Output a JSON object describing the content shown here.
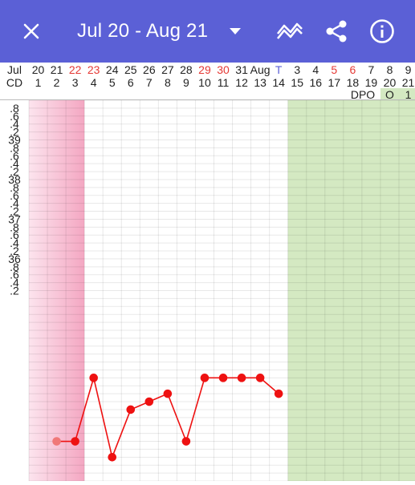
{
  "appbar": {
    "title": "Jul 20 - Aug 21",
    "background": "#5b60d6",
    "icons": [
      "close-icon",
      "chevron-down-icon",
      "chart-toggle-icon",
      "share-icon",
      "info-icon"
    ]
  },
  "header": {
    "row1_label": "Jul",
    "row2_label": "CD",
    "row3_label": "DPO",
    "columns": [
      {
        "date": "20",
        "cd": "1",
        "dpo": "",
        "color": "#222222"
      },
      {
        "date": "21",
        "cd": "2",
        "dpo": "",
        "color": "#222222"
      },
      {
        "date": "22",
        "cd": "3",
        "dpo": "",
        "color": "#e53935"
      },
      {
        "date": "23",
        "cd": "4",
        "dpo": "",
        "color": "#e53935"
      },
      {
        "date": "24",
        "cd": "5",
        "dpo": "",
        "color": "#222222"
      },
      {
        "date": "25",
        "cd": "6",
        "dpo": "",
        "color": "#222222"
      },
      {
        "date": "26",
        "cd": "7",
        "dpo": "",
        "color": "#222222"
      },
      {
        "date": "27",
        "cd": "8",
        "dpo": "",
        "color": "#222222"
      },
      {
        "date": "28",
        "cd": "9",
        "dpo": "",
        "color": "#222222"
      },
      {
        "date": "29",
        "cd": "10",
        "dpo": "",
        "color": "#e53935"
      },
      {
        "date": "30",
        "cd": "11",
        "dpo": "",
        "color": "#e53935"
      },
      {
        "date": "31",
        "cd": "12",
        "dpo": "",
        "color": "#222222"
      },
      {
        "date": "Aug",
        "cd": "13",
        "dpo": "",
        "color": "#222222"
      },
      {
        "date": "T",
        "cd": "14",
        "dpo": "",
        "color": "#5b60d6"
      },
      {
        "date": "3",
        "cd": "15",
        "dpo": "",
        "color": "#222222"
      },
      {
        "date": "4",
        "cd": "16",
        "dpo": "",
        "color": "#222222"
      },
      {
        "date": "5",
        "cd": "17",
        "dpo": "",
        "color": "#e53935"
      },
      {
        "date": "6",
        "cd": "18",
        "dpo": "",
        "color": "#e53935"
      },
      {
        "date": "7",
        "cd": "19",
        "dpo": "",
        "color": "#222222"
      },
      {
        "date": "8",
        "cd": "20",
        "dpo": "O",
        "color": "#222222"
      },
      {
        "date": "9",
        "cd": "21",
        "dpo": "1",
        "color": "#222222"
      }
    ]
  },
  "chart_data": {
    "type": "line",
    "title": "",
    "xlabel": "CD",
    "ylabel": "",
    "y_tick_labels": [
      ".8",
      ".6",
      ".4",
      ".2",
      "39",
      ".8",
      ".6",
      ".4",
      ".2",
      "38",
      ".8",
      ".6",
      ".4",
      ".2",
      "37",
      ".8",
      ".6",
      ".4",
      ".2",
      "36",
      ".8",
      ".6",
      ".4",
      ".2"
    ],
    "ylim": [
      35.1,
      39.9
    ],
    "x": [
      2,
      3,
      4,
      5,
      6,
      7,
      8,
      9,
      10,
      11,
      12,
      13,
      14
    ],
    "series": [
      {
        "values": [
          35.6,
          35.6,
          36.4,
          35.4,
          36.0,
          36.1,
          36.2,
          35.6,
          36.4,
          36.4,
          36.4,
          36.4,
          36.2
        ]
      }
    ],
    "first_point_faded": true,
    "line_color": "#ee1111",
    "period_shading": {
      "days": [
        1,
        3
      ],
      "color": "#f4a7c2"
    },
    "fertile_shading": {
      "days": [
        15,
        21
      ],
      "color": "#d4e9c2"
    },
    "grid": true
  }
}
